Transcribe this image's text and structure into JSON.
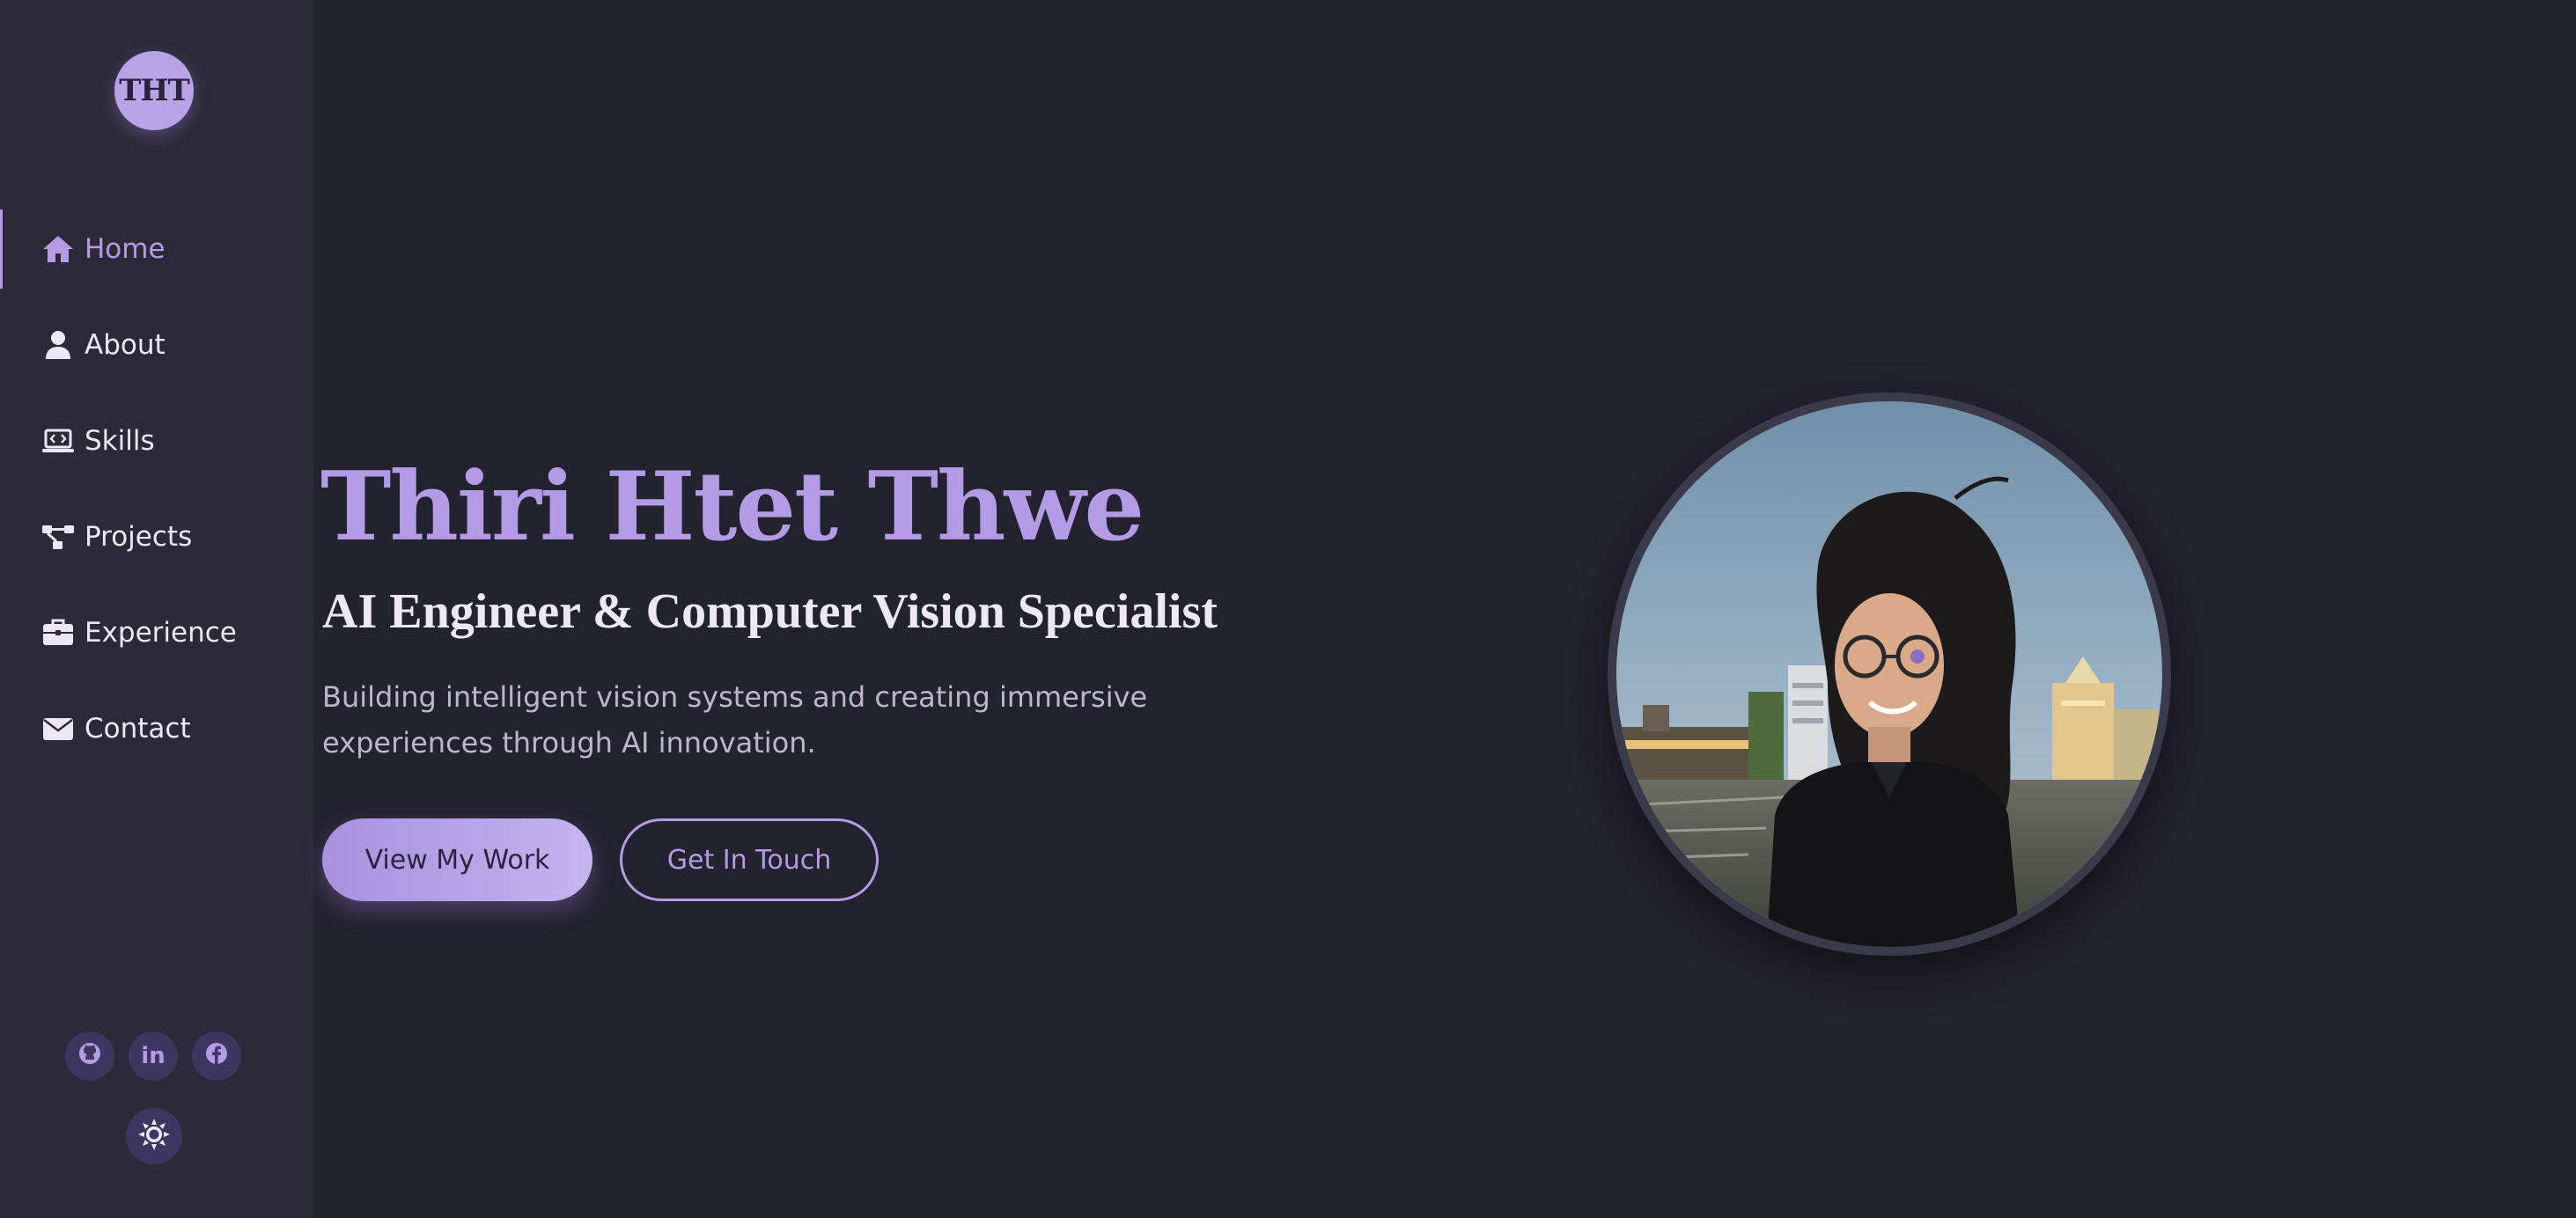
{
  "logo": {
    "text": "THT"
  },
  "nav": {
    "items": [
      {
        "label": "Home",
        "icon": "home-icon",
        "active": true
      },
      {
        "label": "About",
        "icon": "user-icon",
        "active": false
      },
      {
        "label": "Skills",
        "icon": "laptop-code-icon",
        "active": false
      },
      {
        "label": "Projects",
        "icon": "project-diagram-icon",
        "active": false
      },
      {
        "label": "Experience",
        "icon": "briefcase-icon",
        "active": false
      },
      {
        "label": "Contact",
        "icon": "envelope-icon",
        "active": false
      }
    ]
  },
  "socials": {
    "github": {
      "icon": "github-icon"
    },
    "linkedin": {
      "icon": "linkedin-icon",
      "text": "in"
    },
    "facebook": {
      "icon": "facebook-icon"
    }
  },
  "theme_toggle": {
    "icon": "sun-icon"
  },
  "hero": {
    "name": "Thiri Htet Thwe",
    "subtitle": "AI Engineer & Computer Vision Specialist",
    "description": "Building intelligent vision systems and creating immersive experiences through AI innovation.",
    "primary_button": "View My Work",
    "secondary_button": "Get In Touch"
  },
  "colors": {
    "background": "#23222f",
    "sidebar": "#2c2a39",
    "accent": "#b59be6",
    "text": "#ece9f4",
    "muted_text": "#bcb8c9"
  }
}
